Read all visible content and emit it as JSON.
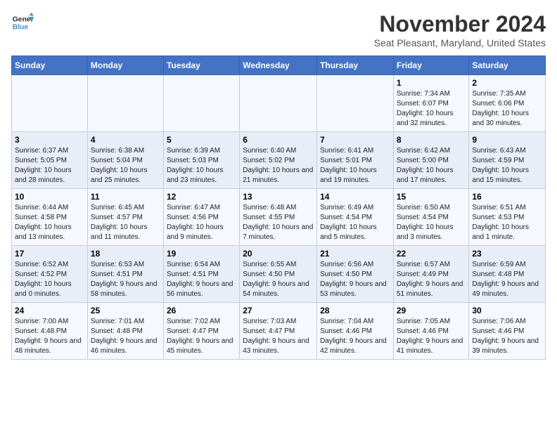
{
  "logo": {
    "line1": "General",
    "line2": "Blue"
  },
  "title": "November 2024",
  "location": "Seat Pleasant, Maryland, United States",
  "weekdays": [
    "Sunday",
    "Monday",
    "Tuesday",
    "Wednesday",
    "Thursday",
    "Friday",
    "Saturday"
  ],
  "weeks": [
    [
      {
        "day": "",
        "info": ""
      },
      {
        "day": "",
        "info": ""
      },
      {
        "day": "",
        "info": ""
      },
      {
        "day": "",
        "info": ""
      },
      {
        "day": "",
        "info": ""
      },
      {
        "day": "1",
        "info": "Sunrise: 7:34 AM\nSunset: 6:07 PM\nDaylight: 10 hours and 32 minutes."
      },
      {
        "day": "2",
        "info": "Sunrise: 7:35 AM\nSunset: 6:06 PM\nDaylight: 10 hours and 30 minutes."
      }
    ],
    [
      {
        "day": "3",
        "info": "Sunrise: 6:37 AM\nSunset: 5:05 PM\nDaylight: 10 hours and 28 minutes."
      },
      {
        "day": "4",
        "info": "Sunrise: 6:38 AM\nSunset: 5:04 PM\nDaylight: 10 hours and 25 minutes."
      },
      {
        "day": "5",
        "info": "Sunrise: 6:39 AM\nSunset: 5:03 PM\nDaylight: 10 hours and 23 minutes."
      },
      {
        "day": "6",
        "info": "Sunrise: 6:40 AM\nSunset: 5:02 PM\nDaylight: 10 hours and 21 minutes."
      },
      {
        "day": "7",
        "info": "Sunrise: 6:41 AM\nSunset: 5:01 PM\nDaylight: 10 hours and 19 minutes."
      },
      {
        "day": "8",
        "info": "Sunrise: 6:42 AM\nSunset: 5:00 PM\nDaylight: 10 hours and 17 minutes."
      },
      {
        "day": "9",
        "info": "Sunrise: 6:43 AM\nSunset: 4:59 PM\nDaylight: 10 hours and 15 minutes."
      }
    ],
    [
      {
        "day": "10",
        "info": "Sunrise: 6:44 AM\nSunset: 4:58 PM\nDaylight: 10 hours and 13 minutes."
      },
      {
        "day": "11",
        "info": "Sunrise: 6:45 AM\nSunset: 4:57 PM\nDaylight: 10 hours and 11 minutes."
      },
      {
        "day": "12",
        "info": "Sunrise: 6:47 AM\nSunset: 4:56 PM\nDaylight: 10 hours and 9 minutes."
      },
      {
        "day": "13",
        "info": "Sunrise: 6:48 AM\nSunset: 4:55 PM\nDaylight: 10 hours and 7 minutes."
      },
      {
        "day": "14",
        "info": "Sunrise: 6:49 AM\nSunset: 4:54 PM\nDaylight: 10 hours and 5 minutes."
      },
      {
        "day": "15",
        "info": "Sunrise: 6:50 AM\nSunset: 4:54 PM\nDaylight: 10 hours and 3 minutes."
      },
      {
        "day": "16",
        "info": "Sunrise: 6:51 AM\nSunset: 4:53 PM\nDaylight: 10 hours and 1 minute."
      }
    ],
    [
      {
        "day": "17",
        "info": "Sunrise: 6:52 AM\nSunset: 4:52 PM\nDaylight: 10 hours and 0 minutes."
      },
      {
        "day": "18",
        "info": "Sunrise: 6:53 AM\nSunset: 4:51 PM\nDaylight: 9 hours and 58 minutes."
      },
      {
        "day": "19",
        "info": "Sunrise: 6:54 AM\nSunset: 4:51 PM\nDaylight: 9 hours and 56 minutes."
      },
      {
        "day": "20",
        "info": "Sunrise: 6:55 AM\nSunset: 4:50 PM\nDaylight: 9 hours and 54 minutes."
      },
      {
        "day": "21",
        "info": "Sunrise: 6:56 AM\nSunset: 4:50 PM\nDaylight: 9 hours and 53 minutes."
      },
      {
        "day": "22",
        "info": "Sunrise: 6:57 AM\nSunset: 4:49 PM\nDaylight: 9 hours and 51 minutes."
      },
      {
        "day": "23",
        "info": "Sunrise: 6:59 AM\nSunset: 4:48 PM\nDaylight: 9 hours and 49 minutes."
      }
    ],
    [
      {
        "day": "24",
        "info": "Sunrise: 7:00 AM\nSunset: 4:48 PM\nDaylight: 9 hours and 48 minutes."
      },
      {
        "day": "25",
        "info": "Sunrise: 7:01 AM\nSunset: 4:48 PM\nDaylight: 9 hours and 46 minutes."
      },
      {
        "day": "26",
        "info": "Sunrise: 7:02 AM\nSunset: 4:47 PM\nDaylight: 9 hours and 45 minutes."
      },
      {
        "day": "27",
        "info": "Sunrise: 7:03 AM\nSunset: 4:47 PM\nDaylight: 9 hours and 43 minutes."
      },
      {
        "day": "28",
        "info": "Sunrise: 7:04 AM\nSunset: 4:46 PM\nDaylight: 9 hours and 42 minutes."
      },
      {
        "day": "29",
        "info": "Sunrise: 7:05 AM\nSunset: 4:46 PM\nDaylight: 9 hours and 41 minutes."
      },
      {
        "day": "30",
        "info": "Sunrise: 7:06 AM\nSunset: 4:46 PM\nDaylight: 9 hours and 39 minutes."
      }
    ]
  ]
}
